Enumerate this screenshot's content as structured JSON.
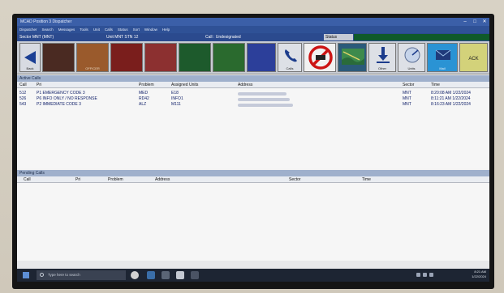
{
  "window": {
    "title": "MCAD Position 3 Dispatcher",
    "controls": [
      "–",
      "□",
      "✕"
    ]
  },
  "menu": [
    "Dispatcher",
    "Search",
    "Messages",
    "Tools",
    "Unit",
    "Calls",
    "Status",
    "Sort",
    "Window",
    "Help"
  ],
  "statusbar": {
    "sector": "Sector MNT (MNT)",
    "unit": "Unit MNT STN 12",
    "cell": "Call : Undesignated",
    "status_label": "Status"
  },
  "toolbar": {
    "back_label": "Back",
    "color_buttons": [
      {
        "label": "",
        "color": "#4a2a22"
      },
      {
        "label": "OFFICER",
        "color": "#9a5a2c"
      },
      {
        "label": "",
        "color": "#7a1e1c"
      },
      {
        "label": "",
        "color": "#8c3030"
      },
      {
        "label": "",
        "color": "#1d5a2c"
      },
      {
        "label": "",
        "color": "#2a6a2e"
      },
      {
        "label": "",
        "color": "#2c3f9a"
      }
    ],
    "icon_buttons": [
      {
        "name": "phone",
        "label": "Calls"
      },
      {
        "name": "no-entry",
        "label": ""
      },
      {
        "name": "map",
        "label": ""
      },
      {
        "name": "download",
        "label": "Other"
      },
      {
        "name": "radar",
        "label": "Units"
      },
      {
        "name": "envelope",
        "label": "Mail"
      },
      {
        "name": "ack",
        "label": "ACK"
      }
    ]
  },
  "active_calls": {
    "title": "Active Calls",
    "columns": [
      "Call",
      "Pri",
      "Problem",
      "Assigned Units",
      "Address",
      "Sector",
      "Time"
    ],
    "rows": [
      {
        "call": "512",
        "pri": "P1 EMERGENCY CODE 3",
        "problem": "MED",
        "units": "E18",
        "sector": "MNT",
        "time": "8:20:08 AM 1/22/2024"
      },
      {
        "call": "526",
        "pri": "P6 INFO ONLY / NO RESPONSE",
        "problem": "RD42",
        "units": "INFO1",
        "sector": "MNT",
        "time": "8:11:21 AM 1/22/2024"
      },
      {
        "call": "543",
        "pri": "P2 IMMEDIATE CODE 3",
        "problem": "ALZ",
        "units": "M111",
        "sector": "MNT",
        "time": "8:16:23 AM 1/22/2024"
      }
    ]
  },
  "pending_calls": {
    "title": "Pending Calls",
    "columns": [
      "Call",
      "Pri",
      "Problem",
      "Address",
      "Sector",
      "Time"
    ]
  },
  "taskbar": {
    "search_placeholder": "Type here to search",
    "clock_time": "8:21 AM",
    "clock_date": "1/22/2024"
  }
}
